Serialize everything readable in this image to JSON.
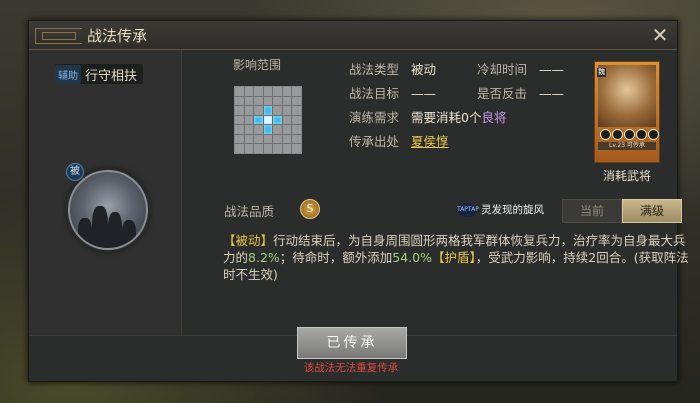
{
  "dialog": {
    "title": "战法传承",
    "close_label": "✕"
  },
  "skill": {
    "role_tag": "辅助",
    "name": "行守相扶",
    "passive_badge": "被"
  },
  "range": {
    "label": "影响范围",
    "pattern": [
      [
        0,
        0,
        0,
        0,
        0,
        0,
        0
      ],
      [
        0,
        0,
        0,
        0,
        0,
        0,
        0
      ],
      [
        0,
        0,
        0,
        1,
        0,
        0,
        0
      ],
      [
        0,
        0,
        1,
        2,
        1,
        0,
        0
      ],
      [
        0,
        0,
        0,
        1,
        0,
        0,
        0
      ],
      [
        0,
        0,
        0,
        0,
        0,
        0,
        0
      ],
      [
        0,
        0,
        0,
        0,
        0,
        0,
        0
      ]
    ]
  },
  "info": {
    "type_label": "战法类型",
    "type_value": "被动",
    "cooldown_label": "冷却时间",
    "cooldown_value": "——",
    "target_label": "战法目标",
    "target_value": "——",
    "counter_label": "是否反击",
    "counter_value": "——",
    "require_label": "演练需求",
    "require_value_prefix": "需要消耗0个",
    "require_value_highlight": "良将",
    "source_label": "传承出处",
    "source_value": "夏侯惇"
  },
  "general_card": {
    "consume_label": "消耗武将",
    "level_text": "Lv.23 可传承"
  },
  "quality": {
    "label": "战法品质",
    "grade": "S"
  },
  "watermark": {
    "logo_text": "TAPTAP",
    "text": "灵发现的旋风"
  },
  "tabs": [
    {
      "label": "当前",
      "active": false
    },
    {
      "label": "满级",
      "active": true
    }
  ],
  "description": {
    "tag": "【被动】",
    "part1": "行动结束后，为自身周围圆形两格我军群体恢复兵力，治疗率为自身最大兵力的",
    "pct1": "8.2%",
    "part2": "；待命时，额外添加",
    "pct2": "54.0%",
    "shield": "【护盾】",
    "part3": "，受武力影响，持续2回合。(获取阵法时不生效)"
  },
  "action": {
    "button_label": "已传承",
    "warning": "该战法无法重复传承"
  }
}
